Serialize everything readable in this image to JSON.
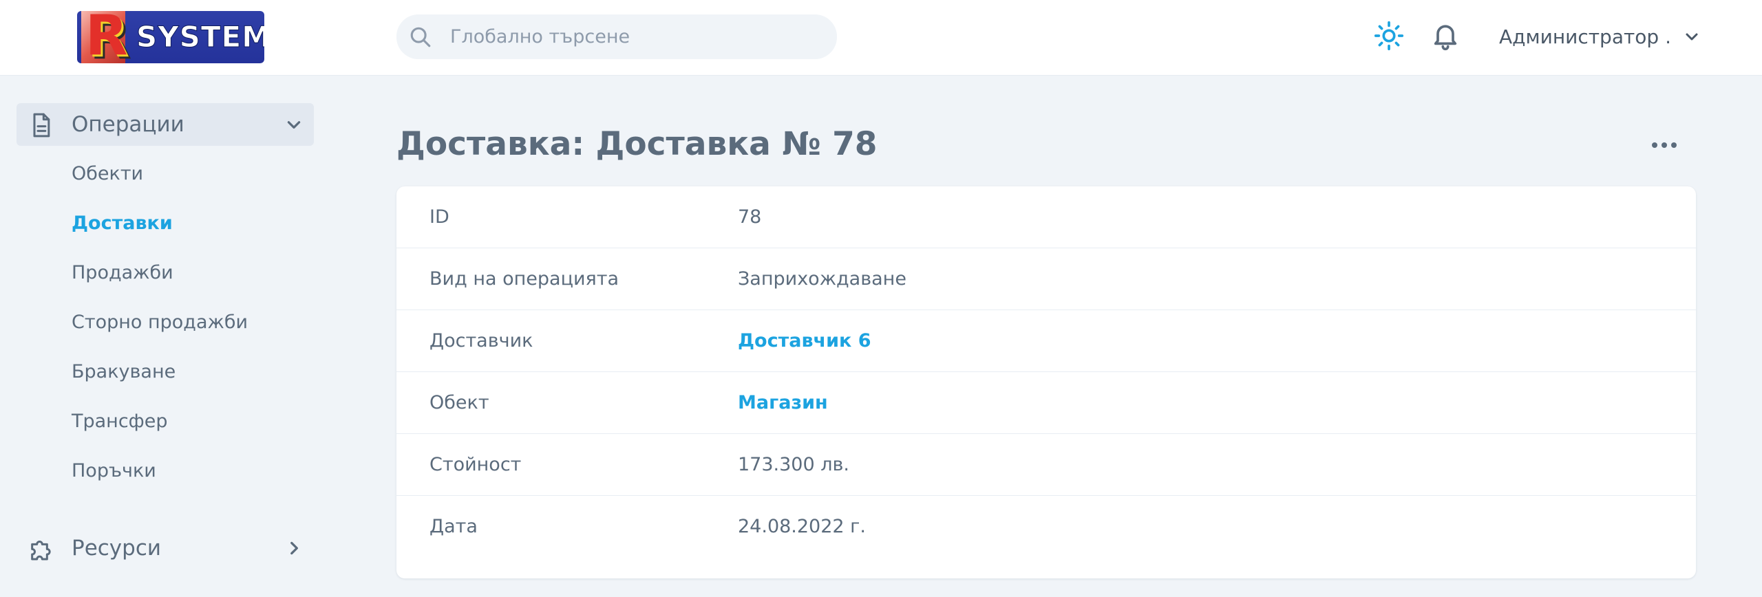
{
  "app": {
    "logo_text": "SYSTEM",
    "logo_letter": "R"
  },
  "search": {
    "placeholder": "Глобално търсене"
  },
  "header": {
    "user_name": "Администратор ."
  },
  "sidebar": {
    "groups": [
      {
        "label": "Операции",
        "icon": "document-icon",
        "expanded": true
      },
      {
        "label": "Ресурси",
        "icon": "puzzle-icon",
        "expanded": false
      }
    ],
    "items": [
      {
        "label": "Обекти"
      },
      {
        "label": "Доставки",
        "active": true
      },
      {
        "label": "Продажби"
      },
      {
        "label": "Сторно продажби"
      },
      {
        "label": "Бракуване"
      },
      {
        "label": "Трансфер"
      },
      {
        "label": "Поръчки"
      }
    ]
  },
  "page": {
    "title": "Доставка: Доставка № 78",
    "fields": [
      {
        "label": "ID",
        "value": "78"
      },
      {
        "label": "Вид на операцията",
        "value": "Заприхождаване"
      },
      {
        "label": "Доставчик",
        "value": "Доставчик 6",
        "link": true
      },
      {
        "label": "Обект",
        "value": "Магазин",
        "link": true
      },
      {
        "label": "Стойност",
        "value": "173.300 лв."
      },
      {
        "label": "Дата",
        "value": "24.08.2022 г."
      }
    ]
  },
  "colors": {
    "accent": "#1ca3e0",
    "text": "#5b6b7c",
    "background": "#f0f4f8"
  }
}
